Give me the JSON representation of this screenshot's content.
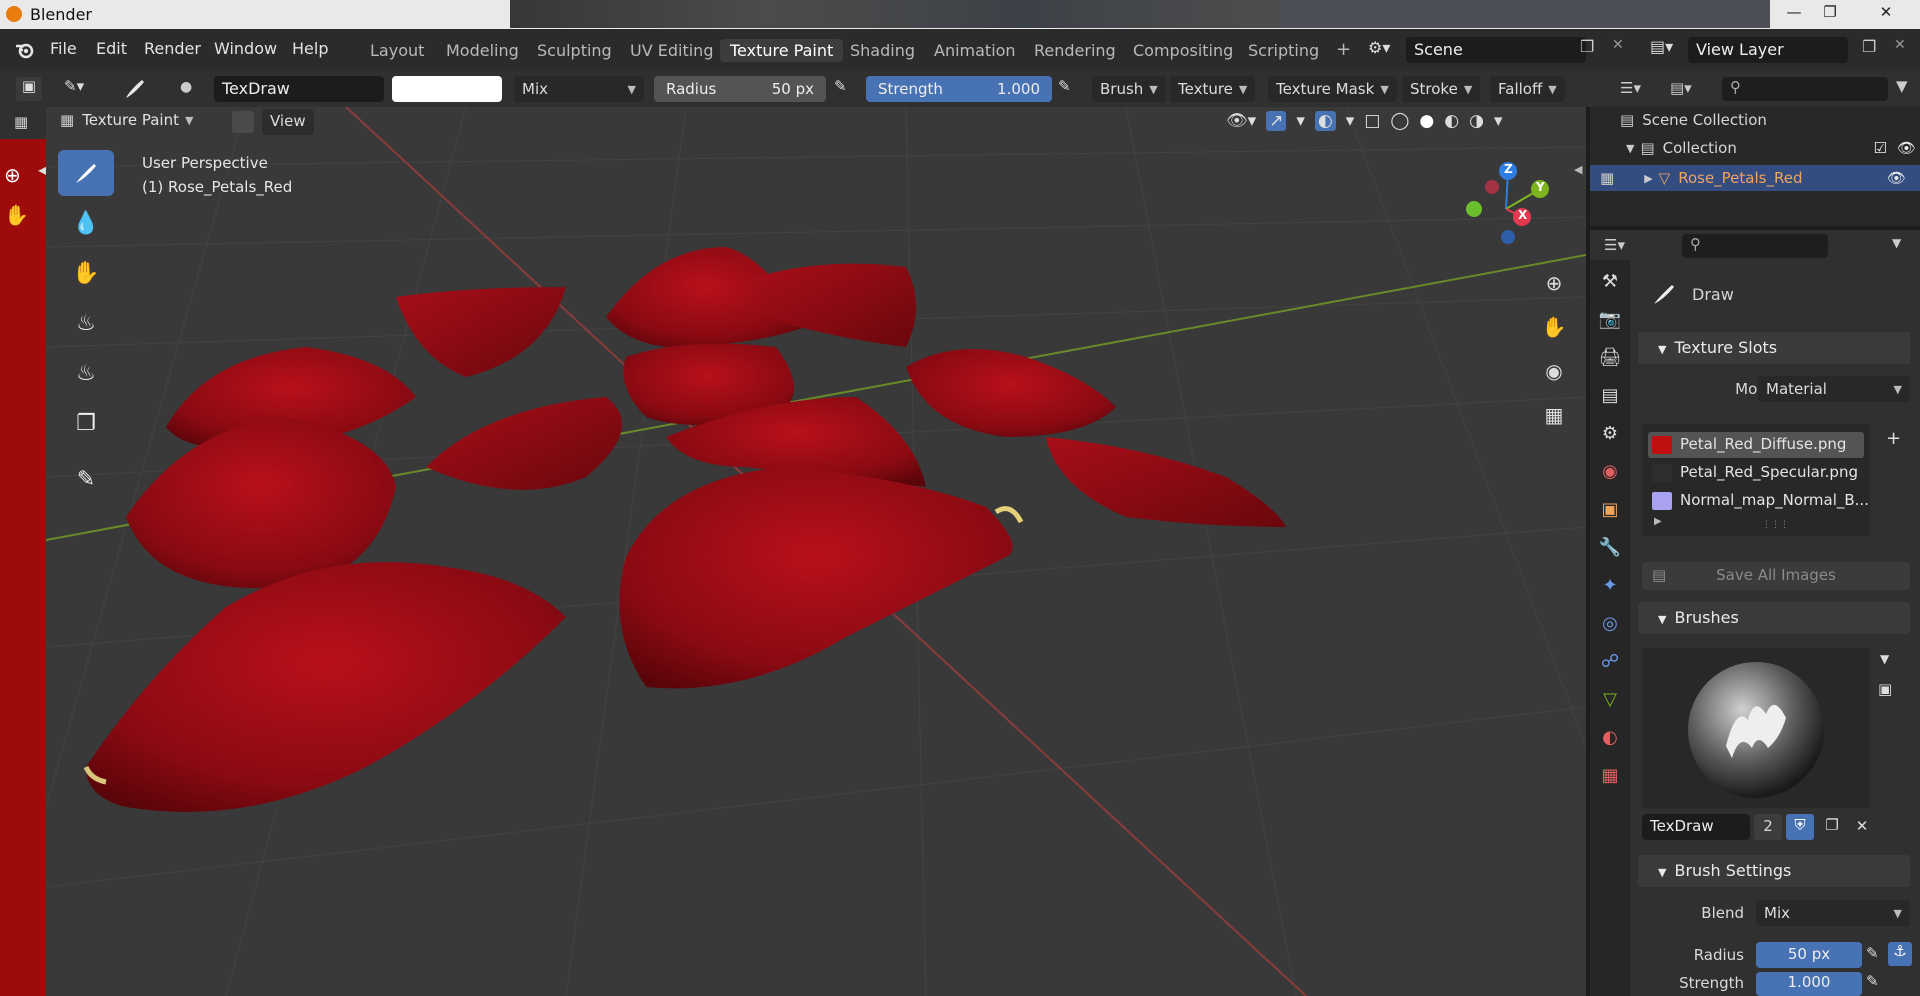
{
  "window": {
    "title": "Blender"
  },
  "menus": [
    "File",
    "Edit",
    "Render",
    "Window",
    "Help"
  ],
  "workspaces": [
    {
      "label": "Layout",
      "active": false
    },
    {
      "label": "Modeling",
      "active": false
    },
    {
      "label": "Sculpting",
      "active": false
    },
    {
      "label": "UV Editing",
      "active": false
    },
    {
      "label": "Texture Paint",
      "active": true
    },
    {
      "label": "Shading",
      "active": false
    },
    {
      "label": "Animation",
      "active": false
    },
    {
      "label": "Rendering",
      "active": false
    },
    {
      "label": "Compositing",
      "active": false
    },
    {
      "label": "Scripting",
      "active": false
    }
  ],
  "add_workspace": "+",
  "scene": {
    "name": "Scene"
  },
  "view_layer": {
    "name": "View Layer"
  },
  "tool_header": {
    "brush_name": "TexDraw",
    "blend": "Mix",
    "radius_label": "Radius",
    "radius_value": "50 px",
    "strength_label": "Strength",
    "strength_value": "1.000",
    "menus": [
      "Brush",
      "Texture",
      "Texture Mask",
      "Stroke",
      "Falloff"
    ]
  },
  "viewport_header": {
    "mode": "Texture Paint",
    "view": "View"
  },
  "viewport": {
    "perspective": "User Perspective",
    "object": "(1) Rose_Petals_Red",
    "gizmo_axes": [
      "Z",
      "Y",
      "X"
    ]
  },
  "outliner": {
    "root": "Scene Collection",
    "collection": "Collection",
    "object": "Rose_Petals_Red"
  },
  "properties": {
    "tool_name": "Draw",
    "texture_slots": {
      "title": "Texture Slots",
      "mode_label": "Mode",
      "mode_value": "Material",
      "slots": [
        {
          "name": "Petal_Red_Diffuse.png",
          "color": "#c01010",
          "selected": true
        },
        {
          "name": "Petal_Red_Specular.png",
          "color": "#2e2e2e",
          "selected": false
        },
        {
          "name": "Normal_map_Normal_B...",
          "color": "#a9a2f0",
          "selected": false
        }
      ],
      "save_all": "Save All Images"
    },
    "brushes": {
      "title": "Brushes",
      "brush_name": "TexDraw",
      "users": "2"
    },
    "brush_settings": {
      "title": "Brush Settings",
      "blend_label": "Blend",
      "blend_value": "Mix",
      "radius_label": "Radius",
      "radius_value": "50 px",
      "strength_label": "Strength",
      "strength_value": "1.000"
    }
  },
  "colors": {
    "accent": "#4772b3",
    "active_object": "#f0a35a",
    "paint_red": "#9e0b0b"
  }
}
